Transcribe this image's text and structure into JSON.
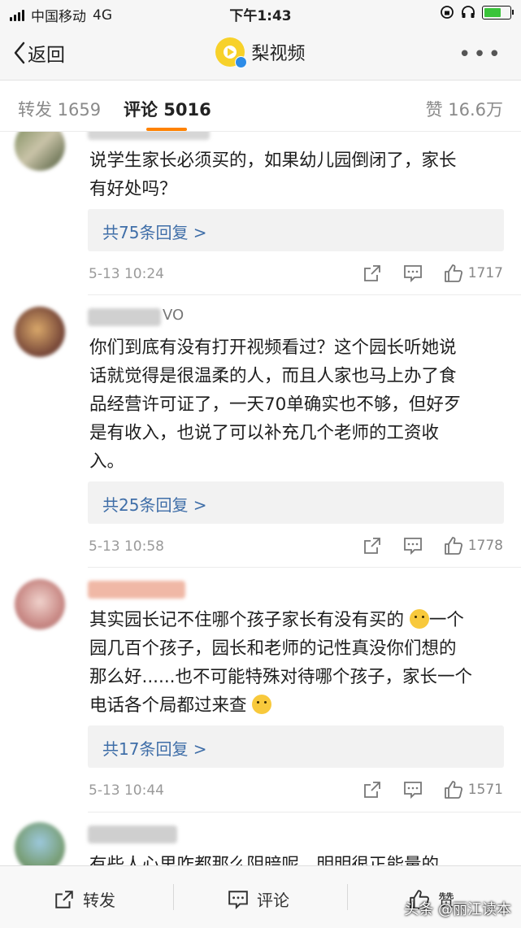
{
  "status_bar": {
    "carrier": "中国移动",
    "network": "4G",
    "time": "下午1:43"
  },
  "nav": {
    "back_label": "返回",
    "title": "梨视频",
    "more_icon": "more-icon"
  },
  "tabs": {
    "repost": "转发 1659",
    "comments": "评论 5016",
    "likes": "赞 16.6万"
  },
  "comments": [
    {
      "text_lines": [
        "说学生家长必须买的，如果幼儿园倒闭了，家长",
        "有好处吗？"
      ],
      "replies": "共75条回复 >",
      "time": "5-13 10:24",
      "likes": "1717"
    },
    {
      "username_fragment": "VO",
      "text_lines": [
        "你们到底有没有打开视频看过？这个园长听她说",
        "话就觉得是很温柔的人，而且人家也马上办了食",
        "品经营许可证了，一天70单确实也不够，但好歹",
        "是有收入，也说了可以补充几个老师的工资收",
        "入。"
      ],
      "replies": "共25条回复 >",
      "time": "5-13 10:58",
      "likes": "1778"
    },
    {
      "text_line1": "其实园长记不住哪个孩子家长有没有买的",
      "text_line1_tail": "一个",
      "text_lines": [
        "园几百个孩子，园长和老师的记性真没你们想的",
        "那么好......也不可能特殊对待哪个孩子，家长一个"
      ],
      "text_line5": "电话各个局都过来查",
      "replies": "共17条回复 >",
      "time": "5-13 10:44",
      "likes": "1571"
    },
    {
      "text_partial": "有些人心里咋都那么阴暗呢，明明很正能量的"
    }
  ],
  "bottom_bar": {
    "repost": "转发",
    "comment": "评论",
    "like": "赞"
  },
  "watermark": "头条 @丽江读本"
}
